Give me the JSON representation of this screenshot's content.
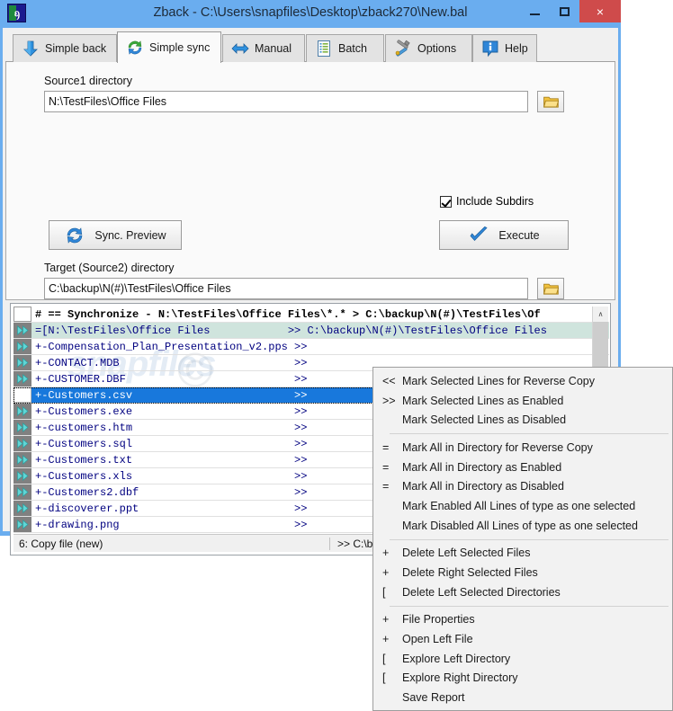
{
  "window": {
    "title": "Zback - C:\\Users\\snapfiles\\Desktop\\zback270\\New.bal",
    "app_icon": "zback-app-icon",
    "minimize_label": "",
    "maximize_label": "",
    "close_label": "×"
  },
  "tabs": [
    {
      "label": "Simple back",
      "icon": "down-arrow-icon",
      "active": false
    },
    {
      "label": "Simple sync",
      "icon": "sync-refresh-icon",
      "active": true
    },
    {
      "label": "Manual",
      "icon": "left-right-arrow-icon",
      "active": false
    },
    {
      "label": "Batch",
      "icon": "document-list-icon",
      "active": false
    },
    {
      "label": "Options",
      "icon": "tools-icon",
      "active": false
    },
    {
      "label": "Help",
      "icon": "info-bubble-icon",
      "active": false
    }
  ],
  "panel": {
    "source1_label": "Source1 directory",
    "source1_value": "N:\\TestFiles\\Office Files",
    "source1_browse_icon": "folder-open-icon",
    "include_subdirs_label": "Include Subdirs",
    "include_subdirs_checked": true,
    "sync_preview_label": "Sync. Preview",
    "sync_preview_icon": "sync-arrows-icon",
    "execute_label": "Execute",
    "execute_icon": "blue-check-icon",
    "target_label": "Target (Source2) directory",
    "target_value": "C:\\backup\\N(#)\\TestFiles\\Office Files",
    "target_browse_icon": "folder-open-icon"
  },
  "list": {
    "watermark": "snapfiles",
    "watermark_c": "©",
    "scroll_up_glyph": "∧",
    "rows": [
      {
        "mark": "none",
        "type": "header",
        "text": "# == Synchronize - N:\\TestFiles\\Office Files\\*.* > C:\\backup\\N(#)\\TestFiles\\Of"
      },
      {
        "mark": "ff",
        "type": "dir",
        "text": "=[N:\\TestFiles\\Office Files            >> C:\\backup\\N(#)\\TestFiles\\Office Files"
      },
      {
        "mark": "ff",
        "type": "file",
        "text": "+-Compensation_Plan_Presentation_v2.pps >>"
      },
      {
        "mark": "ff",
        "type": "file",
        "text": "+-CONTACT.MDB                           >>"
      },
      {
        "mark": "ff",
        "type": "file",
        "text": "+-CUSTOMER.DBF                          >>"
      },
      {
        "mark": "blank",
        "type": "selected",
        "text": "+-Customers.csv                         >>"
      },
      {
        "mark": "ff",
        "type": "file",
        "text": "+-Customers.exe                         >>"
      },
      {
        "mark": "ff",
        "type": "file",
        "text": "+-customers.htm                         >>"
      },
      {
        "mark": "ff",
        "type": "file",
        "text": "+-Customers.sql                         >>"
      },
      {
        "mark": "ff",
        "type": "file",
        "text": "+-Customers.txt                         >>"
      },
      {
        "mark": "ff",
        "type": "file",
        "text": "+-Customers.xls                         >>"
      },
      {
        "mark": "ff",
        "type": "file",
        "text": "+-Customers2.dbf                        >>"
      },
      {
        "mark": "ff",
        "type": "file",
        "text": "+-discoverer.ppt                        >>"
      },
      {
        "mark": "ff",
        "type": "file",
        "text": "+-drawing.png                           >>"
      }
    ],
    "status_left": "6: Copy file (new)",
    "status_right": ">> C:\\ba"
  },
  "context_menu": {
    "groups": [
      [
        {
          "prefix": "<<",
          "label": "Mark Selected Lines for Reverse Copy"
        },
        {
          "prefix": ">>",
          "label": "Mark Selected Lines as Enabled"
        },
        {
          "prefix": "",
          "label": "Mark Selected Lines as Disabled"
        }
      ],
      [
        {
          "prefix": "=",
          "label": "Mark All in Directory for Reverse Copy"
        },
        {
          "prefix": "=",
          "label": "Mark All in Directory as Enabled"
        },
        {
          "prefix": "=",
          "label": "Mark All in Directory as Disabled"
        },
        {
          "prefix": "",
          "label": "Mark Enabled All Lines of type as one selected"
        },
        {
          "prefix": "",
          "label": "Mark Disabled All Lines of type as one selected"
        }
      ],
      [
        {
          "prefix": "+",
          "label": "Delete Left Selected Files"
        },
        {
          "prefix": "+",
          "label": "Delete Right Selected Files"
        },
        {
          "prefix": "[",
          "label": "Delete Left Selected Directories"
        }
      ],
      [
        {
          "prefix": "+",
          "label": "File Properties"
        },
        {
          "prefix": "+",
          "label": "Open Left File"
        },
        {
          "prefix": "[",
          "label": "Explore Left  Directory"
        },
        {
          "prefix": "[",
          "label": "Explore Right Directory"
        },
        {
          "prefix": "",
          "label": "Save Report"
        }
      ]
    ]
  },
  "colors": {
    "titlebar": "#6aadef",
    "close_button": "#cf4b4b",
    "selected_row": "#1878dc",
    "dir_row": "#cfe4dd",
    "mono_text": "#000080"
  }
}
